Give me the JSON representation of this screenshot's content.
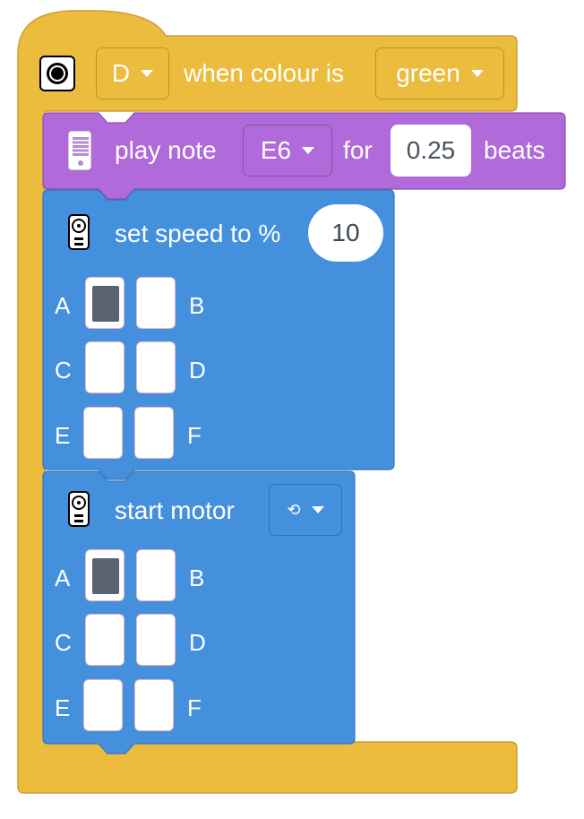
{
  "hat_block": {
    "sensor_port": "D",
    "text_when": "when colour is",
    "colour": "green"
  },
  "play_note_block": {
    "text_play": "play note",
    "note": "E6",
    "text_for": "for",
    "duration": "0.25",
    "text_beats": "beats"
  },
  "set_speed_block": {
    "text": "set speed to %",
    "speed": "10",
    "ports": [
      {
        "label": "A",
        "selected": true
      },
      {
        "label": "B",
        "selected": false
      },
      {
        "label": "C",
        "selected": false
      },
      {
        "label": "D",
        "selected": false
      },
      {
        "label": "E",
        "selected": false
      },
      {
        "label": "F",
        "selected": false
      }
    ]
  },
  "start_motor_block": {
    "text": "start motor",
    "direction_icon": "rotate-icon",
    "ports": [
      {
        "label": "A",
        "selected": true
      },
      {
        "label": "B",
        "selected": false
      },
      {
        "label": "C",
        "selected": false
      },
      {
        "label": "D",
        "selected": false
      },
      {
        "label": "E",
        "selected": false
      },
      {
        "label": "F",
        "selected": false
      }
    ]
  },
  "colors": {
    "event_yellow": "#ECBC3F",
    "sound_purple": "#B06AD9",
    "motor_blue": "#4590DD"
  }
}
